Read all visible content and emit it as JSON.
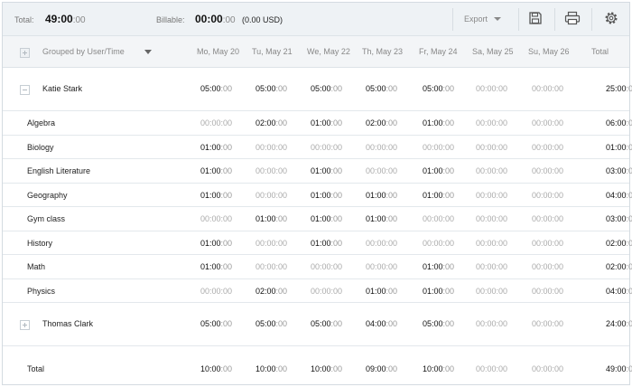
{
  "summary": {
    "total_label": "Total:",
    "total_hours": "49:00",
    "total_minutes": ":00",
    "billable_label": "Billable:",
    "billable_hours": "00:00",
    "billable_minutes": ":00",
    "billable_amount": "(0.00 USD)",
    "export_label": "Export",
    "icons": [
      "save-icon",
      "print-icon",
      "settings-icon"
    ]
  },
  "header": {
    "grouped_by": "Grouped by User/Time",
    "days": [
      "Mo, May 20",
      "Tu, May 21",
      "We, May 22",
      "Th, May 23",
      "Fr, May 24",
      "Sa, May 25",
      "Su, May 26"
    ],
    "total": "Total"
  },
  "groups": [
    {
      "name": "Katie Stark",
      "expanded": true,
      "values": [
        "05:00",
        "05:00",
        "05:00",
        "05:00",
        "05:00",
        "00:00",
        "00:00"
      ],
      "total": "25:00",
      "rows": [
        {
          "name": "Algebra",
          "values": [
            "00:00",
            "02:00",
            "01:00",
            "02:00",
            "01:00",
            "00:00",
            "00:00"
          ],
          "total": "06:00"
        },
        {
          "name": "Biology",
          "values": [
            "01:00",
            "00:00",
            "00:00",
            "00:00",
            "00:00",
            "00:00",
            "00:00"
          ],
          "total": "01:00"
        },
        {
          "name": "English Literature",
          "values": [
            "01:00",
            "00:00",
            "01:00",
            "00:00",
            "01:00",
            "00:00",
            "00:00"
          ],
          "total": "03:00"
        },
        {
          "name": "Geography",
          "values": [
            "01:00",
            "00:00",
            "01:00",
            "01:00",
            "01:00",
            "00:00",
            "00:00"
          ],
          "total": "04:00"
        },
        {
          "name": "Gym class",
          "values": [
            "00:00",
            "01:00",
            "01:00",
            "01:00",
            "00:00",
            "00:00",
            "00:00"
          ],
          "total": "03:00"
        },
        {
          "name": "History",
          "values": [
            "01:00",
            "00:00",
            "01:00",
            "00:00",
            "00:00",
            "00:00",
            "00:00"
          ],
          "total": "02:00"
        },
        {
          "name": "Math",
          "values": [
            "01:00",
            "00:00",
            "00:00",
            "00:00",
            "01:00",
            "00:00",
            "00:00"
          ],
          "total": "02:00"
        },
        {
          "name": "Physics",
          "values": [
            "00:00",
            "02:00",
            "00:00",
            "01:00",
            "01:00",
            "00:00",
            "00:00"
          ],
          "total": "04:00"
        }
      ]
    },
    {
      "name": "Thomas Clark",
      "expanded": false,
      "values": [
        "05:00",
        "05:00",
        "05:00",
        "04:00",
        "05:00",
        "00:00",
        "00:00"
      ],
      "total": "24:00",
      "rows": []
    }
  ],
  "footer": {
    "label": "Total",
    "values": [
      "10:00",
      "10:00",
      "10:00",
      "09:00",
      "10:00",
      "00:00",
      "00:00"
    ],
    "total": "49:00"
  },
  "minutes_suffix": ":00",
  "colors": {
    "summary_bg": "#eef2f5",
    "header_bg": "#f3f5f7",
    "border": "#dde3e8",
    "muted": "#999999"
  }
}
